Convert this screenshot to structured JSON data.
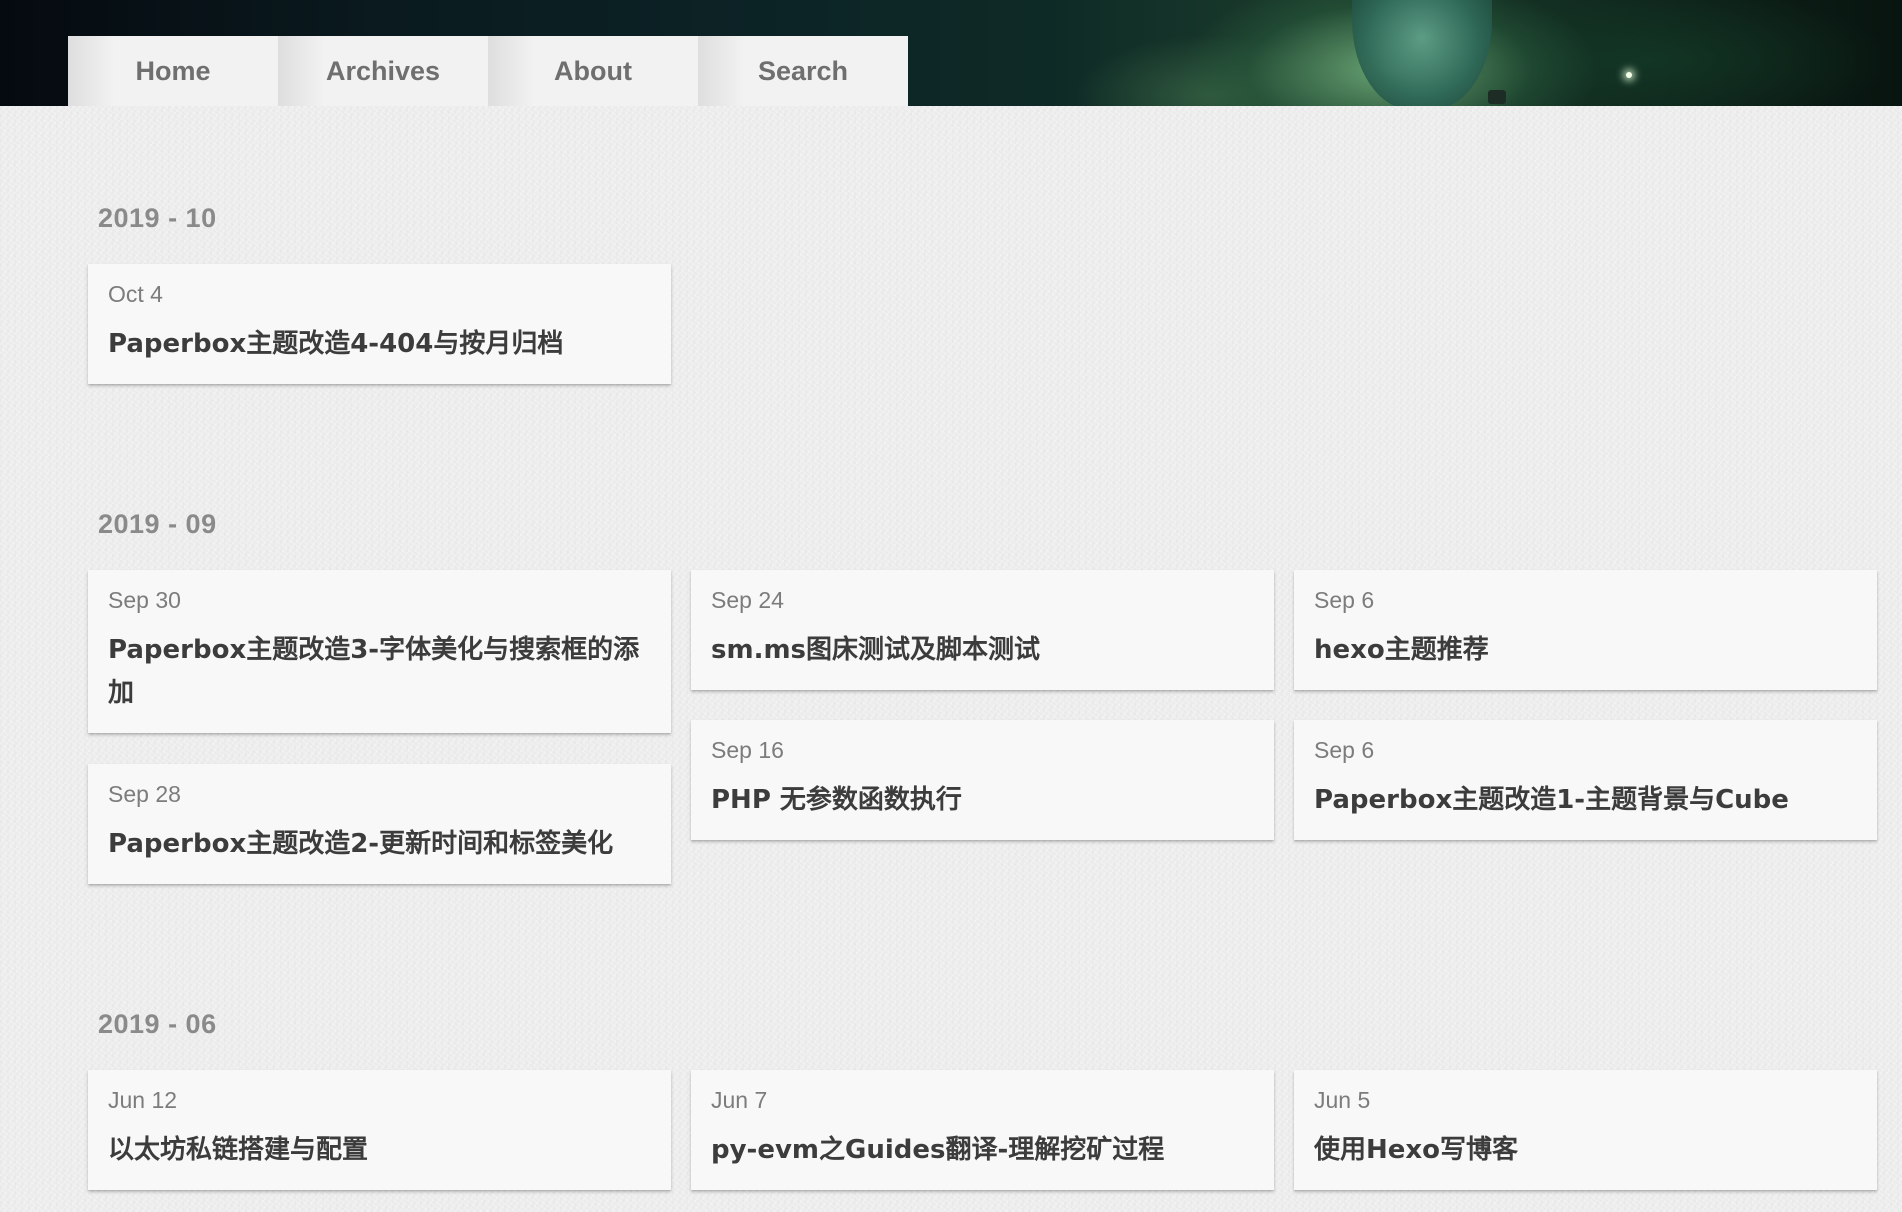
{
  "nav": {
    "items": [
      {
        "label": "Home"
      },
      {
        "label": "Archives"
      },
      {
        "label": "About"
      },
      {
        "label": "Search"
      }
    ]
  },
  "archives": [
    {
      "month": "2019 - 10",
      "posts": [
        {
          "date": "Oct 4",
          "title": "Paperbox主题改造4-404与按月归档"
        }
      ]
    },
    {
      "month": "2019 - 09",
      "posts": [
        {
          "date": "Sep 30",
          "title": "Paperbox主题改造3-字体美化与搜索框的添加"
        },
        {
          "date": "Sep 28",
          "title": "Paperbox主题改造2-更新时间和标签美化"
        },
        {
          "date": "Sep 24",
          "title": "sm.ms图床测试及脚本测试"
        },
        {
          "date": "Sep 16",
          "title": "PHP 无参数函数执行"
        },
        {
          "date": "Sep 6",
          "title": "hexo主题推荐"
        },
        {
          "date": "Sep 6",
          "title": "Paperbox主题改造1-主题背景与Cube"
        }
      ]
    },
    {
      "month": "2019 - 06",
      "posts": [
        {
          "date": "Jun 12",
          "title": "以太坊私链搭建与配置"
        },
        {
          "date": "Jun 7",
          "title": "py-evm之Guides翻译-理解挖矿过程"
        },
        {
          "date": "Jun 5",
          "title": "使用Hexo写博客"
        }
      ]
    }
  ]
}
